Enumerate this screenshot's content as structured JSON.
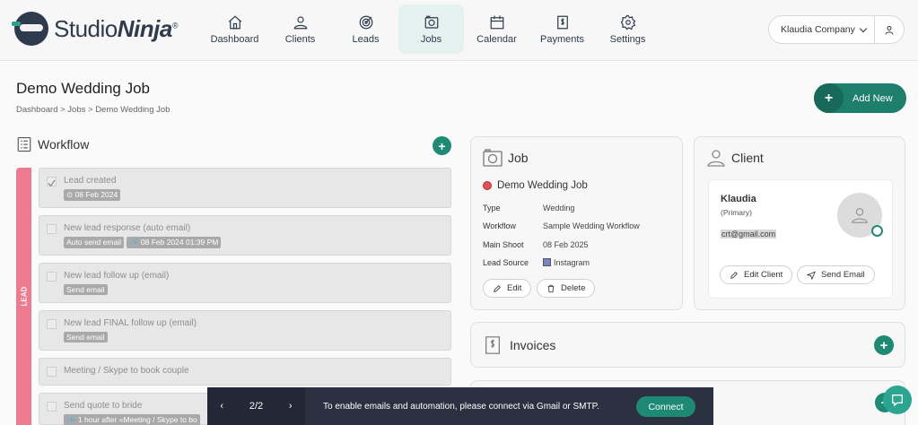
{
  "brand": {
    "name_plain": "Studio",
    "name_bold": "Ninja",
    "mark": "®"
  },
  "nav": [
    {
      "label": "Dashboard",
      "icon": "home-icon"
    },
    {
      "label": "Clients",
      "icon": "user-icon"
    },
    {
      "label": "Leads",
      "icon": "target-icon"
    },
    {
      "label": "Jobs",
      "icon": "camera-icon",
      "active": true
    },
    {
      "label": "Calendar",
      "icon": "calendar-icon"
    },
    {
      "label": "Payments",
      "icon": "payment-icon"
    },
    {
      "label": "Settings",
      "icon": "gear-icon"
    }
  ],
  "company": {
    "label": "Klaudia Company"
  },
  "page": {
    "title": "Demo Wedding Job",
    "breadcrumb": "Dashboard  >  Jobs  >  Demo Wedding Job",
    "add_new": "Add New"
  },
  "workflow": {
    "title": "Workflow",
    "stage": "LEAD",
    "tasks": [
      {
        "title": "Lead created",
        "tags": [
          "⊙ 08 Feb 2024"
        ],
        "checked": true
      },
      {
        "title": "New lead response (auto email)",
        "tags": [
          "Auto send email",
          "🔗 08 Feb 2024 01:39 PM"
        ]
      },
      {
        "title": "New lead follow up (email)",
        "tags": [
          "Send email"
        ]
      },
      {
        "title": "New lead FINAL follow up (email)",
        "tags": [
          "Send email"
        ]
      },
      {
        "title": "Meeting / Skype to book couple",
        "tags": []
      },
      {
        "title": "Send quote to bride",
        "tags": [
          "🔗 1 hour after «Meeting / Skype to bo"
        ]
      }
    ]
  },
  "job": {
    "title": "Job",
    "name": "Demo Wedding Job",
    "fields": [
      {
        "k": "Type",
        "v": "Wedding"
      },
      {
        "k": "Workflow",
        "v": "Sample Wedding Workflow"
      },
      {
        "k": "Main Shoot",
        "v": "08 Feb 2025"
      },
      {
        "k": "Lead Source",
        "v": "Instagram"
      }
    ],
    "edit": "Edit",
    "delete": "Delete",
    "lead_source_color": "#7a84c4"
  },
  "client": {
    "title": "Client",
    "name": "Klaudia",
    "role": "(Primary)",
    "email": "crt@gmail.com",
    "edit": "Edit Client",
    "send": "Send Email"
  },
  "invoices": {
    "title": "Invoices"
  },
  "banner": {
    "page": "2/2",
    "message": "To enable emails and automation, please connect via Gmail or SMTP.",
    "connect": "Connect"
  },
  "colors": {
    "accent": "#1f8a74",
    "lead": "#ed7a8e",
    "dark": "#2b3140"
  }
}
